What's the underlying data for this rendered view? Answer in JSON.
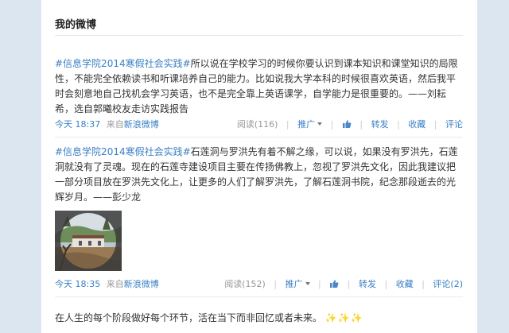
{
  "panel_title": "我的微博",
  "posts": [
    {
      "topic": "#信息学院2014寒假社会实践#",
      "text": "所以说在学校学习的时候你要认识到课本知识和课堂知识的局限性，不能完全依赖读书和听课培养自己的能力。比如说我大学本科的时候很喜欢英语，然后我平时会刻意地自己找机会学习英语，也不是完全靠上英语课学，自学能力是很重要的。——刘耘希，选自郭曦校友走访实践报告",
      "time": "今天 18:37",
      "from_label": "来自",
      "source": "新浪微博",
      "views": "阅读(116)",
      "promote": "推广",
      "like_icon": "thumbs-up-icon",
      "forward": "转发",
      "favorite": "收藏",
      "comment": "评论"
    },
    {
      "topic": "#信息学院2014寒假社会实践#",
      "text": "石莲洞与罗洪先有着不解之缘，可以说，如果没有罗洪先，石莲洞就没有了灵魂。现在的石莲寺建设项目主要在传扬佛教上，忽视了罗洪先文化，因此我建议把一部分项目放在罗洪先文化上，让更多的人们了解罗洪先，了解石莲洞书院，纪念那段逝去的光辉岁月。——彭少龙",
      "time": "今天 18:35",
      "from_label": "来自",
      "source": "新浪微博",
      "views": "阅读(152)",
      "promote": "推广",
      "like_icon": "thumbs-up-icon",
      "forward": "转发",
      "favorite": "收藏",
      "comment": "评论(2)"
    }
  ],
  "last_post": {
    "text": "在人生的每个阶段做好每个环节，活在当下而非回忆或者未来。",
    "emoji": "✨✨✨"
  },
  "colors": {
    "link": "#3a7fc4",
    "muted": "#999999",
    "text": "#333333",
    "page_bg": "#dbe6f1",
    "panel_bg": "#ffffff"
  }
}
